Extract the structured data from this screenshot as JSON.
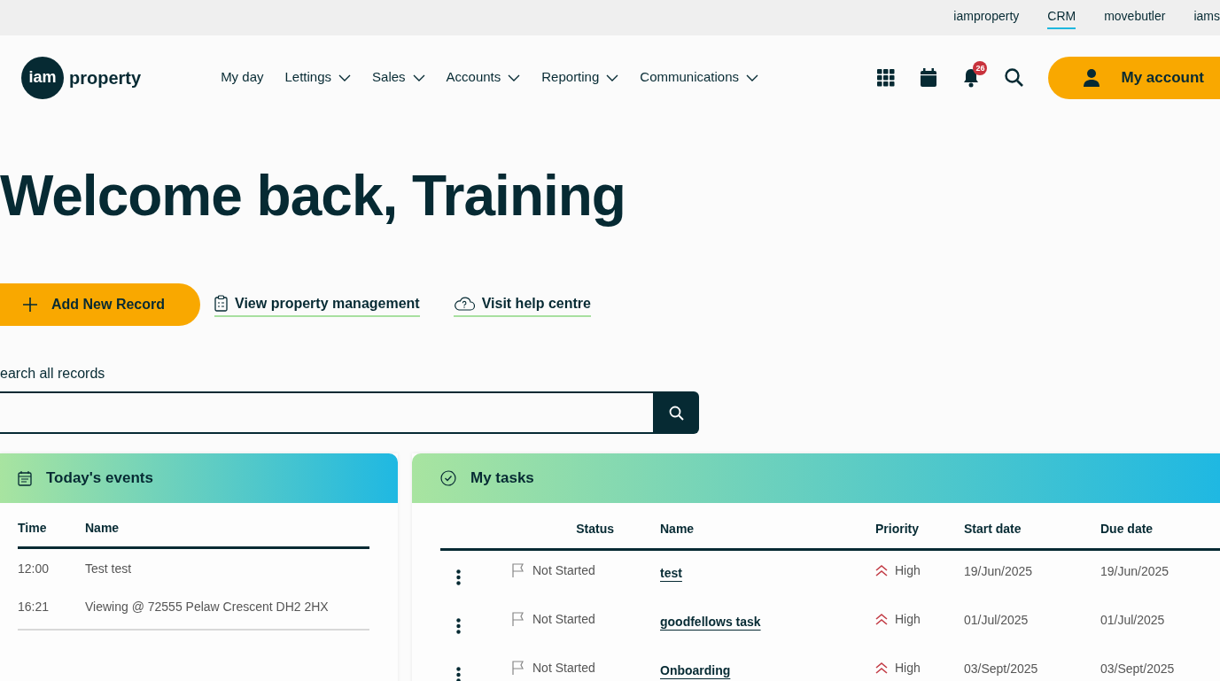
{
  "top_links": [
    {
      "label": "iamproperty",
      "selected": false
    },
    {
      "label": "CRM",
      "selected": true
    },
    {
      "label": "movebutler",
      "selected": false
    },
    {
      "label": "iams",
      "selected": false
    }
  ],
  "logo": {
    "prefix": "iam",
    "word": "property"
  },
  "nav": [
    {
      "label": "My day",
      "dropdown": false
    },
    {
      "label": "Lettings",
      "dropdown": true
    },
    {
      "label": "Sales",
      "dropdown": true
    },
    {
      "label": "Accounts",
      "dropdown": true
    },
    {
      "label": "Reporting",
      "dropdown": true
    },
    {
      "label": "Communications",
      "dropdown": true
    }
  ],
  "notifications": {
    "count": "26"
  },
  "account_button": "My account",
  "heading": "Welcome back, Training",
  "actions": {
    "primary": "Add New Record",
    "links": [
      {
        "label": "View property management",
        "kind": "clipboard"
      },
      {
        "label": "Visit help centre",
        "kind": "cloud"
      }
    ]
  },
  "search": {
    "label": "earch all records"
  },
  "events": {
    "title": "Today's events",
    "columns": [
      "Time",
      "Name"
    ],
    "rows": [
      {
        "time": "12:00",
        "name": "Test test"
      },
      {
        "time": "16:21",
        "name": "Viewing @ 72555 Pelaw Crescent DH2 2HX"
      }
    ]
  },
  "tasks": {
    "title": "My tasks",
    "columns": [
      "Status",
      "Name",
      "Priority",
      "Start date",
      "Due date"
    ],
    "rows": [
      {
        "status": "Not Started",
        "name": "test",
        "priority": "High",
        "start": "19/Jun/2025",
        "due": "19/Jun/2025"
      },
      {
        "status": "Not Started",
        "name": "goodfellows task",
        "priority": "High",
        "start": "01/Jul/2025",
        "due": "01/Jul/2025"
      },
      {
        "status": "Not Started",
        "name": "Onboarding",
        "priority": "High",
        "start": "03/Sept/2025",
        "due": "03/Sept/2025"
      }
    ]
  }
}
